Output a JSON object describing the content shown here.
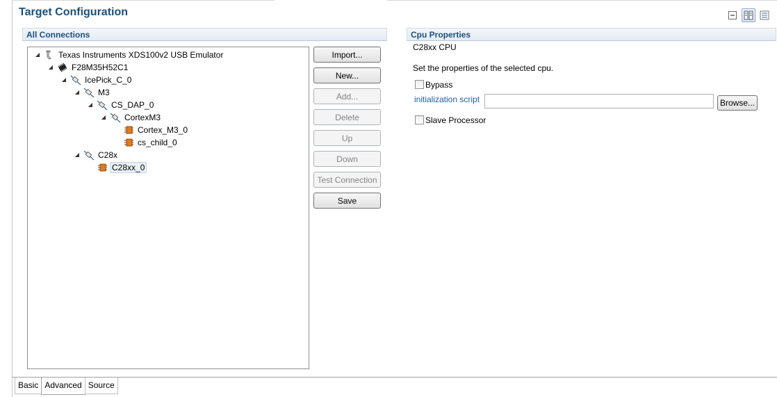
{
  "title": "Target Configuration",
  "left_panel": {
    "header": "All Connections",
    "tree": [
      {
        "label": "Texas Instruments XDS100v2 USB Emulator",
        "icon": "emulator-icon",
        "level": 0
      },
      {
        "label": "F28M35H52C1",
        "icon": "chip-icon",
        "level": 1
      },
      {
        "label": "IcePick_C_0",
        "icon": "router-icon",
        "level": 2
      },
      {
        "label": "M3",
        "icon": "router-icon",
        "level": 3
      },
      {
        "label": "CS_DAP_0",
        "icon": "router-icon",
        "level": 4
      },
      {
        "label": "CortexM3",
        "icon": "router-icon",
        "level": 5
      },
      {
        "label": "Cortex_M3_0",
        "icon": "cpu-icon",
        "level": 6
      },
      {
        "label": "cs_child_0",
        "icon": "cpu-icon",
        "level": 6
      },
      {
        "label": "C28x",
        "icon": "router-icon",
        "level": 3
      },
      {
        "label": "C28xx_0",
        "icon": "cpu-icon",
        "level": 4
      }
    ]
  },
  "buttons": {
    "import": "Import...",
    "new": "New...",
    "add": "Add...",
    "delete": "Delete",
    "up": "Up",
    "down": "Down",
    "test_connection": "Test Connection",
    "save": "Save"
  },
  "right_panel": {
    "header": "Cpu Properties",
    "cpu_name": "C28xx CPU",
    "description": "Set the properties of the selected cpu.",
    "bypass_label": "Bypass",
    "init_script_label": "initialization script",
    "init_script_value": "",
    "browse_label": "Browse...",
    "slave_label": "Slave Processor"
  },
  "tabs": [
    "Basic",
    "Advanced",
    "Source"
  ],
  "colors": {
    "title": "#1c4f7c",
    "link": "#1f5fa8",
    "cpu_icon": "#e07a1f"
  }
}
